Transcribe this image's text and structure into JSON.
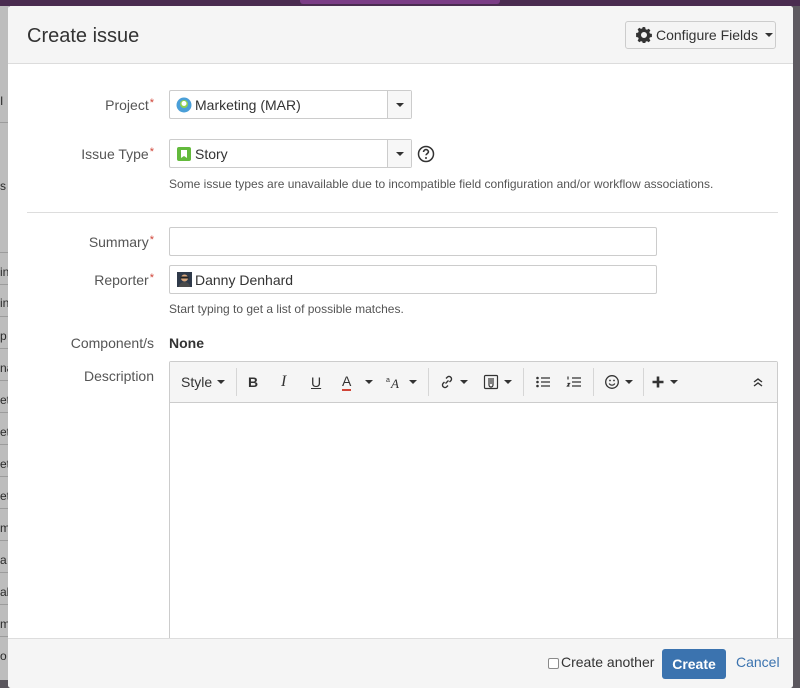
{
  "background": {
    "edge_text": [
      "I",
      "s",
      "in",
      "in",
      "p",
      "na",
      "et",
      "et",
      "et",
      "et",
      "m",
      "a",
      "ab",
      "m",
      "o"
    ]
  },
  "dialog": {
    "title": "Create issue",
    "configure_fields_label": "Configure Fields"
  },
  "form": {
    "project": {
      "label": "Project",
      "value": "Marketing (MAR)"
    },
    "issue_type": {
      "label": "Issue Type",
      "value": "Story",
      "hint": "Some issue types are unavailable due to incompatible field configuration and/or workflow associations."
    },
    "summary": {
      "label": "Summary",
      "value": ""
    },
    "reporter": {
      "label": "Reporter",
      "value": "Danny Denhard",
      "hint": "Start typing to get a list of possible matches."
    },
    "components": {
      "label": "Component/s",
      "value": "None"
    },
    "description": {
      "label": "Description",
      "value": ""
    },
    "required_marker": "*"
  },
  "editor_toolbar": {
    "style_label": "Style",
    "bold": "B",
    "italic": "I",
    "underline": "U",
    "text_color": "A"
  },
  "footer": {
    "create_another_label": "Create another",
    "create_label": "Create",
    "cancel_label": "Cancel"
  },
  "colors": {
    "primary": "#3b73af",
    "required": "#d04437",
    "story_icon": "#63ba3c",
    "text_color_underline": "#d04437"
  }
}
